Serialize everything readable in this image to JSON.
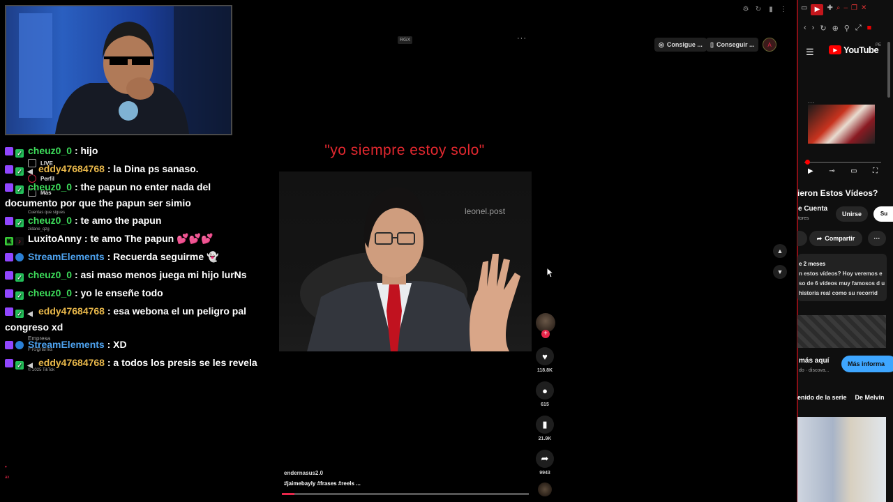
{
  "tiktok": {
    "header": {
      "buttons": [
        {
          "label": "Consigue ...",
          "icon": "coin-icon"
        },
        {
          "label": "Conseguir ...",
          "icon": "phone-icon"
        }
      ]
    },
    "left_nav": [
      {
        "label": "LIVE",
        "icon": "live-icon"
      },
      {
        "label": "Perfil",
        "icon": "profile-icon"
      },
      {
        "label": "Más",
        "icon": "more-icon"
      },
      {
        "label": "Cuentas que sigues",
        "icon": ""
      },
      {
        "label": "zidane_qzg",
        "icon": ""
      },
      {
        "label": "Empresa",
        "icon": ""
      },
      {
        "label": "Programa",
        "icon": ""
      },
      {
        "label": "© 2025 TikTok",
        "icon": ""
      }
    ],
    "video": {
      "badge": "RGX",
      "quote": "\"yo siempre estoy solo\"",
      "watermark": "leonel.post",
      "author": "endernasus2.0",
      "tags": "#jaimebayly  #frases  #reels   ...",
      "progress": 0.05
    },
    "actions": {
      "likes": "118.8K",
      "comments": "615",
      "saves": "21.9K",
      "shares": "9943"
    }
  },
  "chat": [
    {
      "user": "cheuz0_0",
      "color": "green",
      "text": ": hijo",
      "badges": [
        "twitch",
        "check"
      ]
    },
    {
      "user": "eddy47684768",
      "color": "gold",
      "text": ": la Dina ps sanaso.",
      "badges": [
        "twitch",
        "check",
        "mute"
      ]
    },
    {
      "user": "cheuz0_0",
      "color": "green",
      "text": ": the papun no enter nada del documento por que the papun ser simio",
      "badges": [
        "twitch",
        "check"
      ]
    },
    {
      "user": "cheuz0_0",
      "color": "green",
      "text": ": te amo the papun",
      "badges": [
        "twitch",
        "check"
      ]
    },
    {
      "user": "LuxitoAnny",
      "color": "white",
      "text": ": te amo The papun 💕💕💕",
      "badges": [
        "kick",
        "tiktok"
      ]
    },
    {
      "user": "StreamElements",
      "color": "blue",
      "text": ": Recuerda seguirme 👻",
      "badges": [
        "twitch",
        "bot"
      ]
    },
    {
      "user": "cheuz0_0",
      "color": "green",
      "text": ": asi maso menos juega mi hijo lurNs",
      "badges": [
        "twitch",
        "check"
      ]
    },
    {
      "user": "cheuz0_0",
      "color": "green",
      "text": ": yo le enseñe todo",
      "badges": [
        "twitch",
        "check"
      ]
    },
    {
      "user": "eddy47684768",
      "color": "gold",
      "text": ": esa webona el un peligro pal congreso xd",
      "badges": [
        "twitch",
        "check",
        "mute"
      ]
    },
    {
      "user": "StreamElements",
      "color": "blue",
      "text": ": XD",
      "badges": [
        "twitch",
        "bot"
      ]
    },
    {
      "user": "eddy47684768",
      "color": "gold",
      "text": ": a todos los presis se les revela",
      "badges": [
        "twitch",
        "check",
        "mute"
      ]
    }
  ],
  "youtube_panel": {
    "logo": "YouTube",
    "region": "PE",
    "title": "ieron Estos Vídeos?",
    "channel": "e Cuenta",
    "subs": "tores",
    "join": "Unirse",
    "subscribe": "Su",
    "share": "Compartir",
    "desc_ago": "e 2 meses",
    "desc_text": "n estos vídeos? Hoy veremos e so de 6 vídeos muy famosos d u historia real como su recorrid",
    "ad_text": "más aquí",
    "ad_sub": "do · discova...",
    "ad_button": "Más informa",
    "chips": [
      "enido de la serie",
      "De Melvin"
    ]
  },
  "colors": {
    "accent_red": "#e8264a",
    "quote_red": "#e3282f",
    "chat_green": "#3ddc5a",
    "chat_gold": "#e9b84a",
    "chat_blue": "#4ea3f0"
  }
}
